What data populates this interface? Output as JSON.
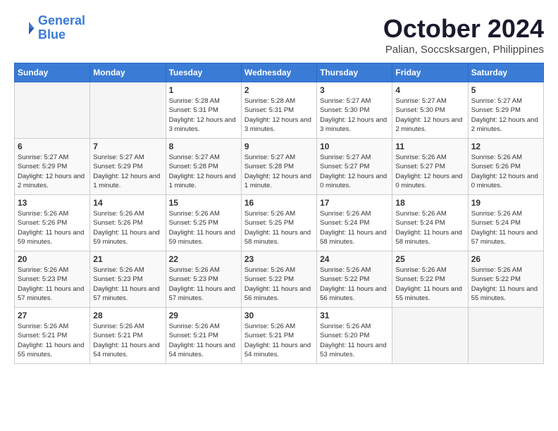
{
  "header": {
    "logo_line1": "General",
    "logo_line2": "Blue",
    "month": "October 2024",
    "location": "Palian, Soccsksargen, Philippines"
  },
  "days_of_week": [
    "Sunday",
    "Monday",
    "Tuesday",
    "Wednesday",
    "Thursday",
    "Friday",
    "Saturday"
  ],
  "weeks": [
    [
      {
        "day": "",
        "info": ""
      },
      {
        "day": "",
        "info": ""
      },
      {
        "day": "1",
        "info": "Sunrise: 5:28 AM\nSunset: 5:31 PM\nDaylight: 12 hours and 3 minutes."
      },
      {
        "day": "2",
        "info": "Sunrise: 5:28 AM\nSunset: 5:31 PM\nDaylight: 12 hours and 3 minutes."
      },
      {
        "day": "3",
        "info": "Sunrise: 5:27 AM\nSunset: 5:30 PM\nDaylight: 12 hours and 3 minutes."
      },
      {
        "day": "4",
        "info": "Sunrise: 5:27 AM\nSunset: 5:30 PM\nDaylight: 12 hours and 2 minutes."
      },
      {
        "day": "5",
        "info": "Sunrise: 5:27 AM\nSunset: 5:29 PM\nDaylight: 12 hours and 2 minutes."
      }
    ],
    [
      {
        "day": "6",
        "info": "Sunrise: 5:27 AM\nSunset: 5:29 PM\nDaylight: 12 hours and 2 minutes."
      },
      {
        "day": "7",
        "info": "Sunrise: 5:27 AM\nSunset: 5:29 PM\nDaylight: 12 hours and 1 minute."
      },
      {
        "day": "8",
        "info": "Sunrise: 5:27 AM\nSunset: 5:28 PM\nDaylight: 12 hours and 1 minute."
      },
      {
        "day": "9",
        "info": "Sunrise: 5:27 AM\nSunset: 5:28 PM\nDaylight: 12 hours and 1 minute."
      },
      {
        "day": "10",
        "info": "Sunrise: 5:27 AM\nSunset: 5:27 PM\nDaylight: 12 hours and 0 minutes."
      },
      {
        "day": "11",
        "info": "Sunrise: 5:26 AM\nSunset: 5:27 PM\nDaylight: 12 hours and 0 minutes."
      },
      {
        "day": "12",
        "info": "Sunrise: 5:26 AM\nSunset: 5:26 PM\nDaylight: 12 hours and 0 minutes."
      }
    ],
    [
      {
        "day": "13",
        "info": "Sunrise: 5:26 AM\nSunset: 5:26 PM\nDaylight: 11 hours and 59 minutes."
      },
      {
        "day": "14",
        "info": "Sunrise: 5:26 AM\nSunset: 5:26 PM\nDaylight: 11 hours and 59 minutes."
      },
      {
        "day": "15",
        "info": "Sunrise: 5:26 AM\nSunset: 5:25 PM\nDaylight: 11 hours and 59 minutes."
      },
      {
        "day": "16",
        "info": "Sunrise: 5:26 AM\nSunset: 5:25 PM\nDaylight: 11 hours and 58 minutes."
      },
      {
        "day": "17",
        "info": "Sunrise: 5:26 AM\nSunset: 5:24 PM\nDaylight: 11 hours and 58 minutes."
      },
      {
        "day": "18",
        "info": "Sunrise: 5:26 AM\nSunset: 5:24 PM\nDaylight: 11 hours and 58 minutes."
      },
      {
        "day": "19",
        "info": "Sunrise: 5:26 AM\nSunset: 5:24 PM\nDaylight: 11 hours and 57 minutes."
      }
    ],
    [
      {
        "day": "20",
        "info": "Sunrise: 5:26 AM\nSunset: 5:23 PM\nDaylight: 11 hours and 57 minutes."
      },
      {
        "day": "21",
        "info": "Sunrise: 5:26 AM\nSunset: 5:23 PM\nDaylight: 11 hours and 57 minutes."
      },
      {
        "day": "22",
        "info": "Sunrise: 5:26 AM\nSunset: 5:23 PM\nDaylight: 11 hours and 57 minutes."
      },
      {
        "day": "23",
        "info": "Sunrise: 5:26 AM\nSunset: 5:22 PM\nDaylight: 11 hours and 56 minutes."
      },
      {
        "day": "24",
        "info": "Sunrise: 5:26 AM\nSunset: 5:22 PM\nDaylight: 11 hours and 56 minutes."
      },
      {
        "day": "25",
        "info": "Sunrise: 5:26 AM\nSunset: 5:22 PM\nDaylight: 11 hours and 55 minutes."
      },
      {
        "day": "26",
        "info": "Sunrise: 5:26 AM\nSunset: 5:22 PM\nDaylight: 11 hours and 55 minutes."
      }
    ],
    [
      {
        "day": "27",
        "info": "Sunrise: 5:26 AM\nSunset: 5:21 PM\nDaylight: 11 hours and 55 minutes."
      },
      {
        "day": "28",
        "info": "Sunrise: 5:26 AM\nSunset: 5:21 PM\nDaylight: 11 hours and 54 minutes."
      },
      {
        "day": "29",
        "info": "Sunrise: 5:26 AM\nSunset: 5:21 PM\nDaylight: 11 hours and 54 minutes."
      },
      {
        "day": "30",
        "info": "Sunrise: 5:26 AM\nSunset: 5:21 PM\nDaylight: 11 hours and 54 minutes."
      },
      {
        "day": "31",
        "info": "Sunrise: 5:26 AM\nSunset: 5:20 PM\nDaylight: 11 hours and 53 minutes."
      },
      {
        "day": "",
        "info": ""
      },
      {
        "day": "",
        "info": ""
      }
    ]
  ]
}
